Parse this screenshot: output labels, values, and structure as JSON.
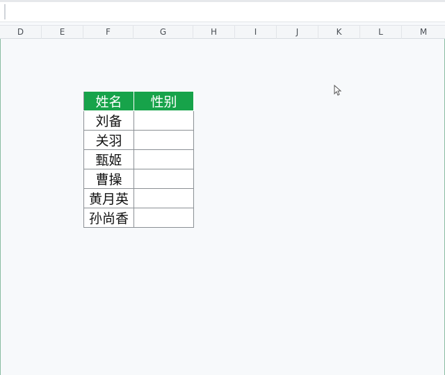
{
  "formula_bar": {
    "value": ""
  },
  "columns": [
    "D",
    "E",
    "F",
    "G",
    "H",
    "I",
    "J",
    "K",
    "L",
    "M"
  ],
  "table": {
    "headers": [
      "姓名",
      "性别"
    ],
    "rows": [
      [
        "刘备",
        ""
      ],
      [
        "关羽",
        ""
      ],
      [
        "甄姬",
        ""
      ],
      [
        "曹操",
        ""
      ],
      [
        "黄月英",
        ""
      ],
      [
        "孙尚香",
        ""
      ]
    ]
  },
  "colors": {
    "header_fill": "#17a34a",
    "header_text": "#ffffff",
    "background": "#f7f9fb"
  },
  "icons": {
    "cursor": "arrow-pointer-icon"
  }
}
